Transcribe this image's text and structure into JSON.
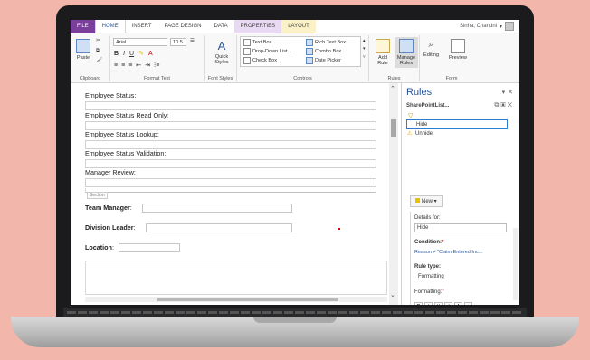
{
  "ribbon_tabs": [
    "FILE",
    "HOME",
    "INSERT",
    "PAGE DESIGN",
    "DATA",
    "PROPERTIES",
    "LAYOUT"
  ],
  "user": {
    "name": "Sinha, Chandni"
  },
  "ribbon": {
    "paste_label": "Paste",
    "clipboard_label": "Clipboard",
    "font_name": "Arial",
    "font_size": "10.5",
    "format_text_label": "Format Text",
    "quick_styles_label": "Quick Styles",
    "font_styles_label": "Font Styles",
    "controls": [
      "Text Box",
      "Rich Text Box",
      "Drop-Down List...",
      "Combo Box",
      "Check Box",
      "Date Picker"
    ],
    "controls_label": "Controls",
    "add_rule_label": "Add Rule",
    "manage_rules_label": "Manage Rules",
    "rules_label": "Rules",
    "editing_label": "Editing",
    "preview_label": "Preview",
    "form_label": "Form"
  },
  "form": {
    "fields": [
      "Employee Status:",
      "Employee Status Read Only:",
      "Employee Status Lookup:",
      "Employee Status Validation:",
      "Manager Review:"
    ],
    "section_tag": "Section",
    "team_manager": "Team Manager",
    "division_leader": "Division Leader",
    "location": "Location",
    "colon": ":"
  },
  "rules_pane": {
    "title": "Rules",
    "list_name": "SharePointList...",
    "rules": [
      "Hide",
      "Unhide"
    ],
    "new_button": "New ▾",
    "details_for_label": "Details for:",
    "details_for_value": "Hide",
    "condition_label": "Condition:",
    "condition_value": "Reason ≠ \"Claim Entered Inc...",
    "rule_type_label": "Rule type:",
    "rule_type_value": "Formatting",
    "formatting_label": "Formatting:",
    "required_mark": "*"
  },
  "colors": {
    "file_tab": "#7a3e9b",
    "accent": "#2b579a",
    "background": "#f2b6aa"
  }
}
